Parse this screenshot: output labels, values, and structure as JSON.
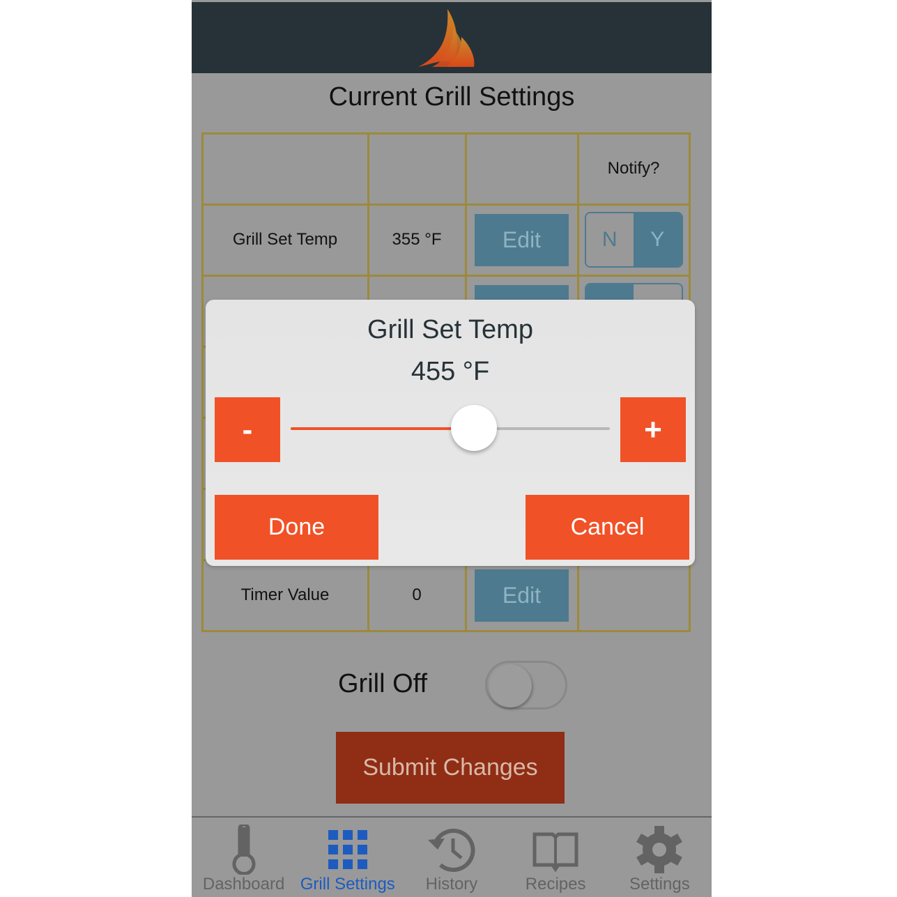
{
  "header": {
    "logo": "flame-logo"
  },
  "page_title": "Current Grill Settings",
  "table": {
    "header": [
      "",
      "",
      "",
      "Notify?"
    ],
    "rows": [
      {
        "label": "Grill Set Temp",
        "value": "355 °F",
        "edit": "Edit",
        "notify": {
          "n": "N",
          "y": "Y",
          "selected": "Y"
        }
      },
      {
        "label": "",
        "value": "",
        "edit": "",
        "notify": {
          "n": "",
          "y": "",
          "selected": "N"
        }
      },
      {
        "label": "",
        "value": "",
        "edit": ""
      },
      {
        "label": "",
        "value": "",
        "edit": ""
      },
      {
        "label": "",
        "value": "",
        "edit": ""
      },
      {
        "label": "Timer Value",
        "value": "0",
        "edit": "Edit"
      }
    ]
  },
  "modal": {
    "title": "Grill Set Temp",
    "value": "455 °F",
    "minus": "-",
    "plus": "+",
    "slider_fraction": 0.574,
    "done": "Done",
    "cancel": "Cancel"
  },
  "grill_off": {
    "label": "Grill Off",
    "on": false
  },
  "submit": "Submit Changes",
  "tabs": [
    {
      "label": "Dashboard",
      "icon": "thermometer-icon"
    },
    {
      "label": "Grill Settings",
      "icon": "grid-icon",
      "active": true
    },
    {
      "label": "History",
      "icon": "history-icon"
    },
    {
      "label": "Recipes",
      "icon": "book-icon"
    },
    {
      "label": "Settings",
      "icon": "gear-icon"
    }
  ],
  "colors": {
    "accent": "#f15127",
    "header": "#263238",
    "active_tab": "#1d5bbf"
  }
}
